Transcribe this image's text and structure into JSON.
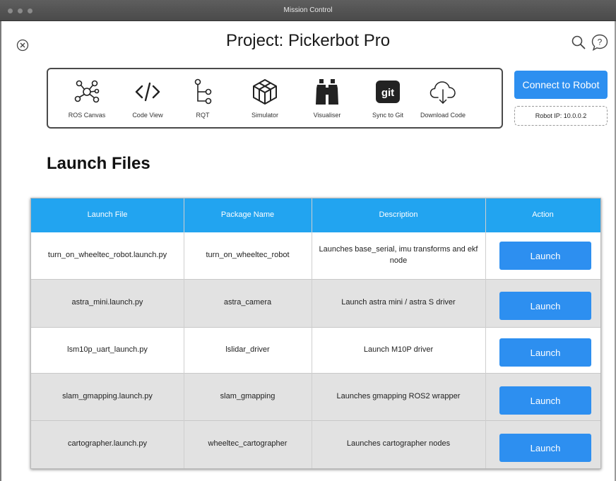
{
  "window": {
    "title": "Mission Control"
  },
  "header": {
    "title": "Project: Pickerbot Pro"
  },
  "toolbar": {
    "items": [
      {
        "label": "ROS Canvas",
        "icon": "network-graph-icon"
      },
      {
        "label": "Code View",
        "icon": "code-brackets-icon"
      },
      {
        "label": "RQT",
        "icon": "tree-branch-icon"
      },
      {
        "label": "Simulator",
        "icon": "cube-icon"
      },
      {
        "label": "Visualiser",
        "icon": "binoculars-icon"
      },
      {
        "label": "Sync to Git",
        "icon": "git-icon",
        "badge": "git"
      },
      {
        "label": "Download Code",
        "icon": "cloud-download-icon"
      }
    ]
  },
  "connect": {
    "label": "Connect to Robot",
    "ip": "Robot IP: 10.0.0.2"
  },
  "section": {
    "title": "Launch Files"
  },
  "table": {
    "columns": [
      "Launch File",
      "Package Name",
      "Description",
      "Action"
    ],
    "rows": [
      {
        "file": "turn_on_wheeltec_robot.launch.py",
        "package": "turn_on_wheeltec_robot",
        "description": "Launches base_serial, imu transforms and ekf node",
        "action": "Launch"
      },
      {
        "file": "astra_mini.launch.py",
        "package": "astra_camera",
        "description": "Launch astra mini / astra S driver",
        "action": "Launch"
      },
      {
        "file": "lsm10p_uart_launch.py",
        "package": "lslidar_driver",
        "description": "Launch M10P driver",
        "action": "Launch"
      },
      {
        "file": "slam_gmapping.launch.py",
        "package": "slam_gmapping",
        "description": "Launches gmapping ROS2 wrapper",
        "action": "Launch"
      },
      {
        "file": "cartographer.launch.py",
        "package": "wheeltec_cartographer",
        "description": "Launches cartographer nodes",
        "action": "Launch"
      }
    ]
  },
  "colors": {
    "accent": "#2d8ff0",
    "table_header": "#22a4f0",
    "row_alt": "#e2e2e2",
    "row_white": "#ffffff",
    "titlebar": "#4f4f4f"
  }
}
